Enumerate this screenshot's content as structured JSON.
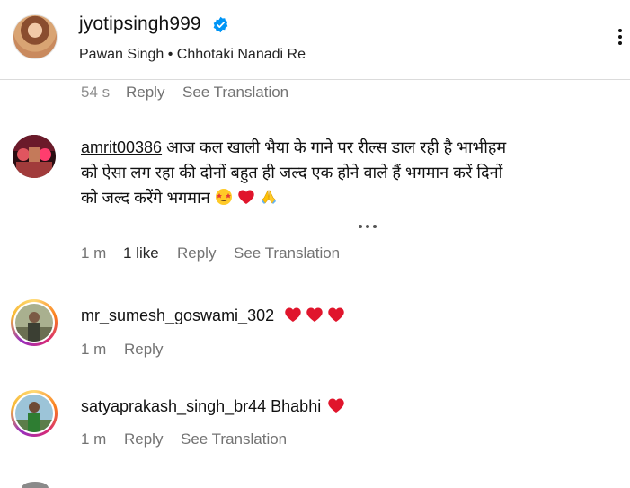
{
  "header": {
    "username": "jyotipsingh999",
    "song": "Pawan Singh • Chhotaki Nanadi Re"
  },
  "partial_comment": {
    "time": "54 s",
    "reply": "Reply",
    "translate": "See Translation"
  },
  "comments": [
    {
      "user": "amrit00386",
      "text_line1": "आज कल खाली भैया के गाने पर रील्स डाल रही है भाभीहम",
      "text_line2": "को ऐसा लग रहा की दोनों बहुत ही जल्द एक होने वाले हैं भगमान करें दिनों",
      "text_line3": "को जल्द करेंगे भगमान",
      "emojis": [
        "star-struck",
        "red-heart",
        "folded-hands"
      ],
      "time": "1 m",
      "likes": "1 like",
      "reply": "Reply",
      "translate": "See Translation"
    },
    {
      "user": "mr_sumesh_goswami_302",
      "text": "",
      "emojis": [
        "red-heart",
        "red-heart",
        "red-heart"
      ],
      "time": "1 m",
      "reply": "Reply"
    },
    {
      "user": "satyaprakash_singh_br44",
      "text": "Bhabhi",
      "emojis": [
        "red-heart"
      ],
      "time": "1 m",
      "reply": "Reply",
      "translate": "See Translation"
    }
  ],
  "colors": {
    "heart": "#e0152c",
    "verified": "#0095f6",
    "meta_text": "#737373",
    "divider": "#dbdbdb"
  }
}
